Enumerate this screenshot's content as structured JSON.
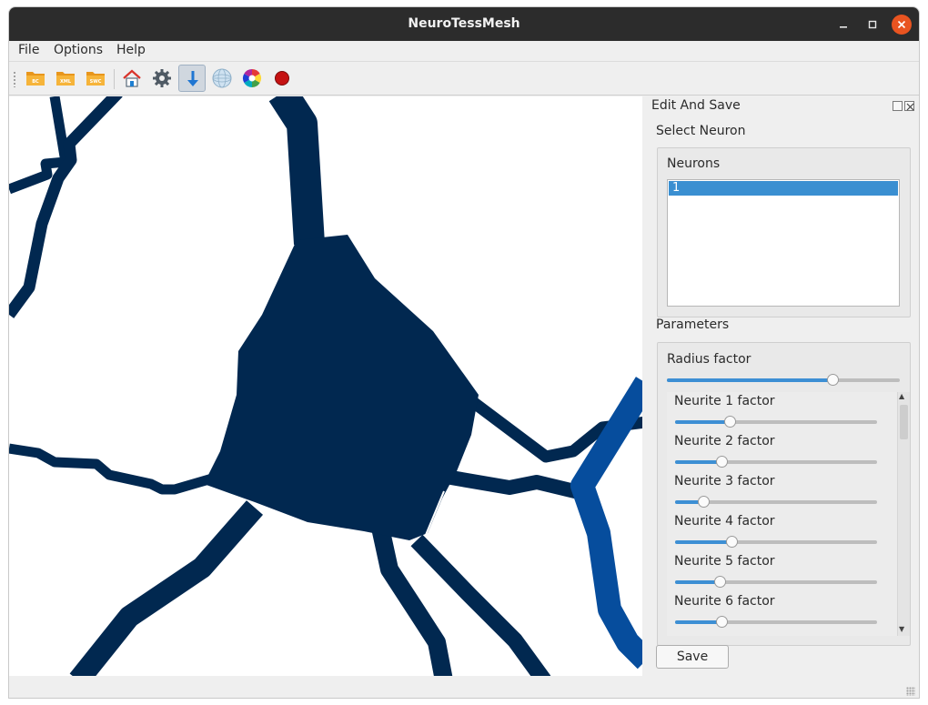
{
  "window": {
    "title": "NeuroTessMesh"
  },
  "menu": [
    {
      "label": "File"
    },
    {
      "label": "Options"
    },
    {
      "label": "Help"
    }
  ],
  "toolbar": {
    "buttons": [
      {
        "icon": "folder-bc-icon",
        "text": "BC"
      },
      {
        "icon": "folder-xml-icon",
        "text": "XML"
      },
      {
        "icon": "folder-swc-icon",
        "text": "SWC"
      },
      {
        "icon": "home-icon"
      },
      {
        "icon": "gear-icon"
      },
      {
        "icon": "down-arrow-icon",
        "active": true
      },
      {
        "icon": "sphere-icon"
      },
      {
        "icon": "color-wheel-icon"
      },
      {
        "icon": "record-icon"
      }
    ]
  },
  "colors": {
    "neuron_dark": "#012850",
    "neuron_blue": "#064d9d",
    "selection": "#3a8fd1",
    "titlebar": "#2c2c2c",
    "close": "#e95420"
  },
  "dock": {
    "title": "Edit And Save",
    "select_neuron": {
      "label": "Select Neuron",
      "list_label": "Neurons",
      "items": [
        "1"
      ],
      "selected_index": 0
    },
    "parameters": {
      "label": "Parameters",
      "radius": {
        "label": "Radius factor",
        "value": 0.71
      },
      "neurites": [
        {
          "label": "Neurite 1 factor",
          "value": 0.27
        },
        {
          "label": "Neurite 2 factor",
          "value": 0.23
        },
        {
          "label": "Neurite 3 factor",
          "value": 0.14
        },
        {
          "label": "Neurite 4 factor",
          "value": 0.28
        },
        {
          "label": "Neurite 5 factor",
          "value": 0.22
        },
        {
          "label": "Neurite 6 factor",
          "value": 0.23
        }
      ]
    },
    "save_label": "Save"
  }
}
